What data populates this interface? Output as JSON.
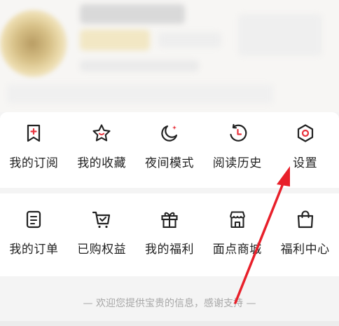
{
  "menu_row1": [
    {
      "label": "我的订阅",
      "icon": "bookmark-plus-icon"
    },
    {
      "label": "我的收藏",
      "icon": "star-icon"
    },
    {
      "label": "夜间模式",
      "icon": "moon-icon"
    },
    {
      "label": "阅读历史",
      "icon": "history-clock-icon"
    },
    {
      "label": "设置",
      "icon": "settings-gear-icon"
    }
  ],
  "menu_row2": [
    {
      "label": "我的订单",
      "icon": "order-clipboard-icon"
    },
    {
      "label": "已购权益",
      "icon": "cart-check-icon"
    },
    {
      "label": "我的福利",
      "icon": "gift-icon"
    },
    {
      "label": "面点商城",
      "icon": "store-icon"
    },
    {
      "label": "福利中心",
      "icon": "shopping-bag-icon"
    }
  ],
  "footer_note": "— 欢迎您提供宝贵的信息，感谢支持 —",
  "colors": {
    "accent_red": "#e8323c",
    "arrow_red": "#e8202a"
  }
}
